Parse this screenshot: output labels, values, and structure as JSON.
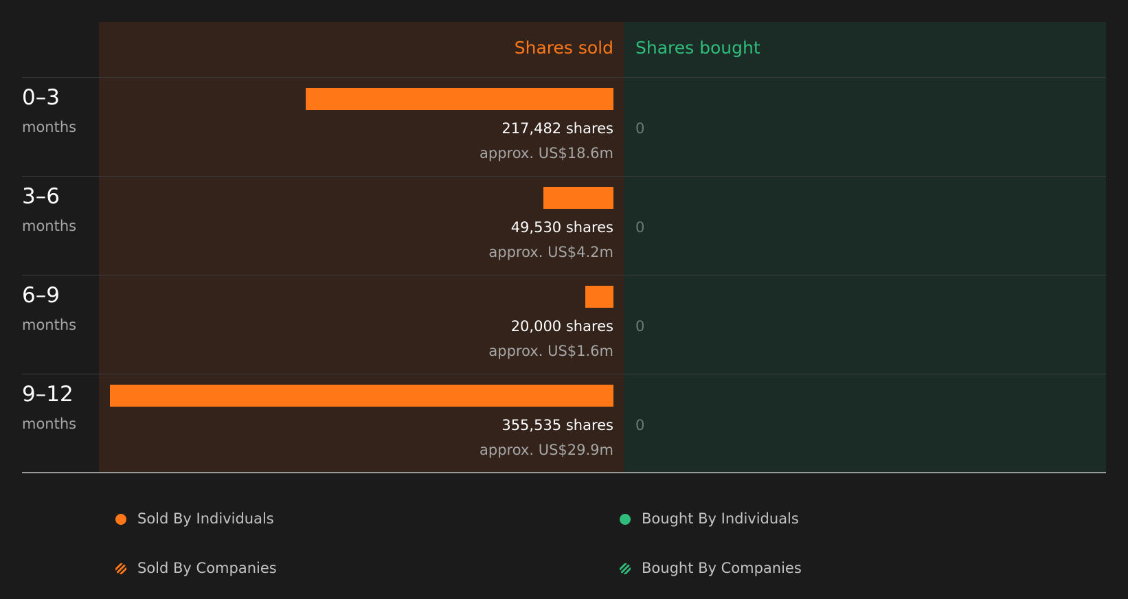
{
  "colors": {
    "sold": "#ff7717",
    "bought": "#2ebd7a",
    "sold_panel": "#33231b",
    "bought_panel": "#1b2b25"
  },
  "headers": {
    "sold": "Shares sold",
    "bought": "Shares bought"
  },
  "chart_data": {
    "type": "bar",
    "orientation": "horizontal-diverging",
    "categories": [
      "0–3",
      "3–6",
      "6–9",
      "9–12"
    ],
    "category_unit": "months",
    "series": [
      {
        "name": "Shares sold",
        "values": [
          217482,
          49530,
          20000,
          355535
        ],
        "value_labels": [
          "217,482 shares",
          "49,530 shares",
          "20,000 shares",
          "355,535 shares"
        ],
        "approx_labels": [
          "approx. US$18.6m",
          "approx. US$4.2m",
          "approx. US$1.6m",
          "approx. US$29.9m"
        ]
      },
      {
        "name": "Shares bought",
        "values": [
          0,
          0,
          0,
          0
        ],
        "value_labels": [
          "0",
          "0",
          "0",
          "0"
        ]
      }
    ]
  },
  "legend": [
    {
      "label": "Sold By Individuals",
      "color": "#ff7717",
      "pattern": "solid"
    },
    {
      "label": "Bought By Individuals",
      "color": "#2ebd7a",
      "pattern": "solid"
    },
    {
      "label": "Sold By Companies",
      "color": "#ff7717",
      "pattern": "hatched"
    },
    {
      "label": "Bought By Companies",
      "color": "#2ebd7a",
      "pattern": "hatched"
    }
  ]
}
